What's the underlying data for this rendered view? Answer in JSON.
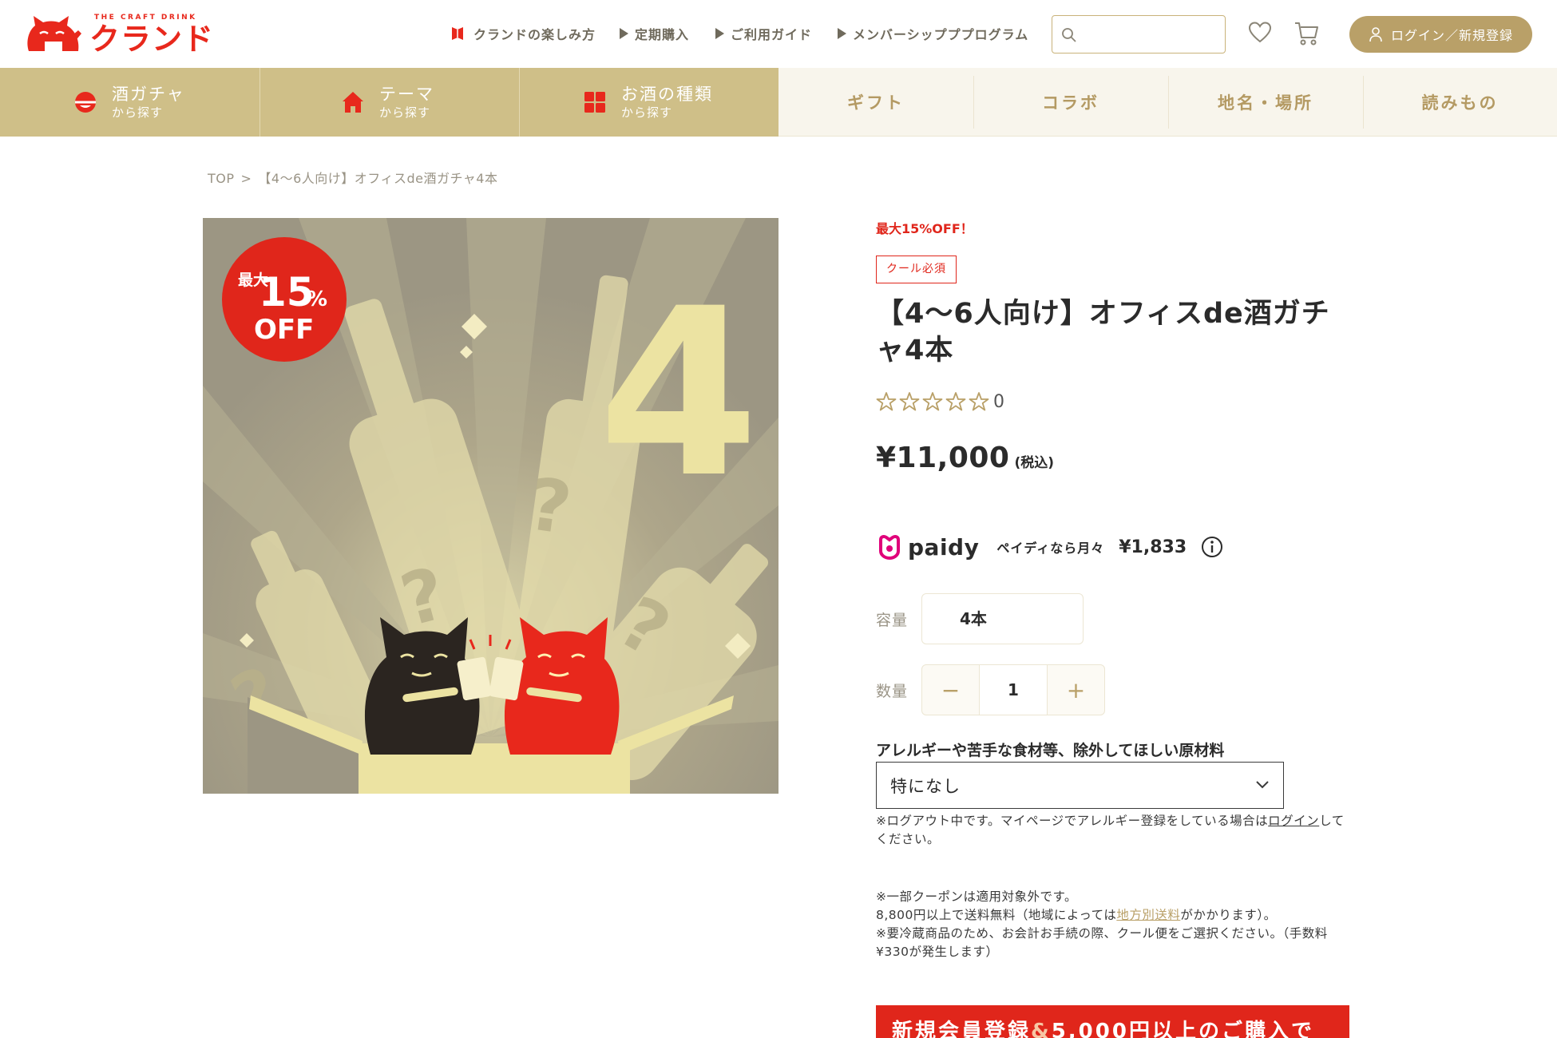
{
  "header": {
    "logo_tagline": "THE CRAFT DRINK",
    "logo_wordmark": "クランド",
    "nav": [
      {
        "label": "クランドの楽しみ方",
        "icon": "bookmark-flag-icon"
      },
      {
        "label": "定期購入",
        "icon": "triangle-right-icon"
      },
      {
        "label": "ご利用ガイド",
        "icon": "triangle-right-icon"
      },
      {
        "label": "メンバーシップププログラム",
        "icon": "triangle-right-icon"
      }
    ],
    "search": {
      "placeholder": "",
      "value": ""
    },
    "login_label": "ログイン／新規登録"
  },
  "categories": {
    "primary": [
      {
        "title": "酒ガチャ",
        "sub": "から探す",
        "icon": "sake-gacha-icon"
      },
      {
        "title": "テーマ",
        "sub": "から探す",
        "icon": "house-icon"
      },
      {
        "title": "お酒の種類",
        "sub": "から探す",
        "icon": "grid-icon"
      }
    ],
    "secondary": [
      "ギフト",
      "コラボ",
      "地名・場所",
      "読みもの"
    ]
  },
  "breadcrumb": {
    "items": [
      "TOP",
      ">",
      "【4〜6人向け】オフィスde酒ガチャ4本"
    ]
  },
  "product_image": {
    "badge_top": "最大",
    "badge_percent": "15",
    "badge_unit": "%",
    "badge_off": "OFF",
    "count_numeral": "4",
    "question_mark": "?"
  },
  "product": {
    "sale_note": "最大15%OFF！",
    "cool_badge": "クール必須",
    "title": "【4〜6人向け】オフィスde酒ガチャ4本",
    "rating_stars": 0,
    "rating_count": "0",
    "price": "¥11,000",
    "tax_label": "(税込)",
    "paidy": {
      "brand": "paidy",
      "text": "ペイディなら月々",
      "amount": "¥1,833"
    },
    "volume_label": "容量",
    "volume_value": "4本",
    "quantity_label": "数量",
    "quantity_minus": "−",
    "quantity_value": "1",
    "quantity_plus": "+",
    "allergy_label": "アレルギーや苦手な食材等、除外してほしい原材料",
    "allergy_value": "特になし",
    "allergy_note_before": "※ログアウト中です。マイページでアレルギー登録をしている場合は",
    "allergy_note_link": "ログイン",
    "allergy_note_after": "してください。",
    "note1": "※一部クーポンは適用対象外です。",
    "note2_before": "8,800円以上で送料無料（地域によっては",
    "note2_link": "地方別送料",
    "note2_after": "がかかります）。",
    "note3": "※要冷蔵商品のため、お会計お手続の際、クール便をご選択ください。（手数料¥330が発生します）",
    "banner_part1": "新規会員登録",
    "banner_amp": "&",
    "banner_part2": "5,000円以上のご購入で"
  },
  "colors": {
    "brand_red": "#e8281c",
    "gold": "#b9a068",
    "category_gold": "#cfbf88",
    "sale_red": "#e0261b"
  }
}
